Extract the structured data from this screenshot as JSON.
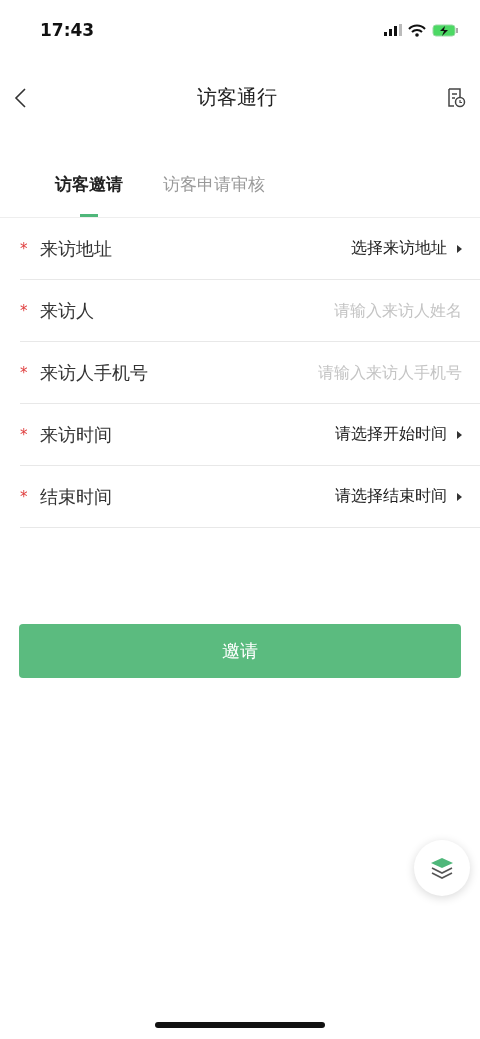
{
  "status_bar": {
    "time": "17:43"
  },
  "nav": {
    "title": "访客通行"
  },
  "tabs": [
    {
      "label": "访客邀请",
      "selected": true
    },
    {
      "label": "访客申请审核",
      "selected": false
    }
  ],
  "fields": [
    {
      "kind": "select",
      "mark": "*",
      "label": "来访地址",
      "value": "选择来访地址"
    },
    {
      "kind": "input",
      "mark": "*",
      "label": "来访人",
      "placeholder": "请输入来访人姓名"
    },
    {
      "kind": "input",
      "mark": "*",
      "label": "来访人手机号",
      "placeholder": "请输入来访人手机号"
    },
    {
      "kind": "select",
      "mark": "*",
      "label": "来访时间",
      "value": "请选择开始时间"
    },
    {
      "kind": "select",
      "mark": "*",
      "label": "结束时间",
      "value": "请选择结束时间"
    }
  ],
  "submit": {
    "label": "邀请"
  }
}
